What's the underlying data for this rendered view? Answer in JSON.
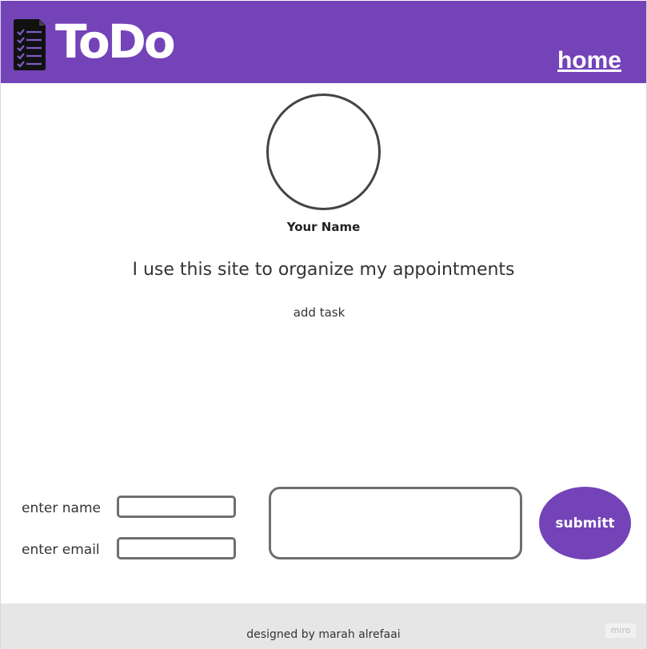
{
  "header": {
    "logo_text": "ToDo",
    "home_label": "home",
    "logo_icon": "checklist-document-icon",
    "bg_color": "#7443b8"
  },
  "profile": {
    "name": "Your Name",
    "bio": "I use this site to organize my appointments",
    "add_task_label": "add task"
  },
  "form": {
    "name_label": "enter name",
    "email_label": "enter email",
    "submit_label": "submitt",
    "accent_color": "#7443b8"
  },
  "footer": {
    "credit": "designed by marah alrefaai",
    "badge": "miro"
  }
}
